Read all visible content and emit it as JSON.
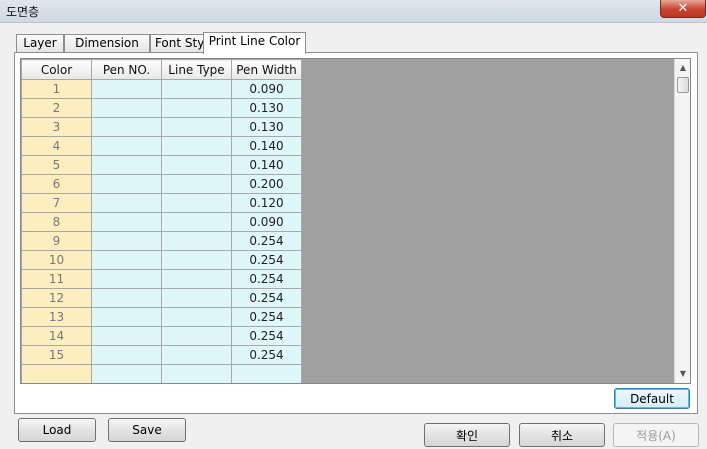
{
  "window": {
    "title": "도면층",
    "close_glyph": "✕"
  },
  "tabs": [
    {
      "label": "Layer"
    },
    {
      "label": "Dimension"
    },
    {
      "label": "Font Style"
    },
    {
      "label": "Print Line Color",
      "active": true
    }
  ],
  "grid": {
    "columns": [
      "Color",
      "Pen NO.",
      "Line Type",
      "Pen Width"
    ],
    "rows": [
      {
        "color": "1",
        "pen_no": "",
        "line_type": "",
        "pen_width": "0.090"
      },
      {
        "color": "2",
        "pen_no": "",
        "line_type": "",
        "pen_width": "0.130"
      },
      {
        "color": "3",
        "pen_no": "",
        "line_type": "",
        "pen_width": "0.130"
      },
      {
        "color": "4",
        "pen_no": "",
        "line_type": "",
        "pen_width": "0.140"
      },
      {
        "color": "5",
        "pen_no": "",
        "line_type": "",
        "pen_width": "0.140"
      },
      {
        "color": "6",
        "pen_no": "",
        "line_type": "",
        "pen_width": "0.200"
      },
      {
        "color": "7",
        "pen_no": "",
        "line_type": "",
        "pen_width": "0.120"
      },
      {
        "color": "8",
        "pen_no": "",
        "line_type": "",
        "pen_width": "0.090"
      },
      {
        "color": "9",
        "pen_no": "",
        "line_type": "",
        "pen_width": "0.254"
      },
      {
        "color": "10",
        "pen_no": "",
        "line_type": "",
        "pen_width": "0.254"
      },
      {
        "color": "11",
        "pen_no": "",
        "line_type": "",
        "pen_width": "0.254"
      },
      {
        "color": "12",
        "pen_no": "",
        "line_type": "",
        "pen_width": "0.254"
      },
      {
        "color": "13",
        "pen_no": "",
        "line_type": "",
        "pen_width": "0.254"
      },
      {
        "color": "14",
        "pen_no": "",
        "line_type": "",
        "pen_width": "0.254"
      },
      {
        "color": "15",
        "pen_no": "",
        "line_type": "",
        "pen_width": "0.254"
      },
      {
        "color": "",
        "pen_no": "",
        "line_type": "",
        "pen_width": ""
      }
    ],
    "colors": {
      "color_col_bg": "#fdeebf",
      "cell_bg": "#dff7f7",
      "empty_area": "#a0a0a0"
    },
    "scroll_up_glyph": "▲",
    "scroll_down_glyph": "▼"
  },
  "buttons": {
    "default_label": "Default",
    "load_label": "Load",
    "save_label": "Save",
    "ok_label": "확인",
    "cancel_label": "취소",
    "apply_label": "적용(A)"
  }
}
